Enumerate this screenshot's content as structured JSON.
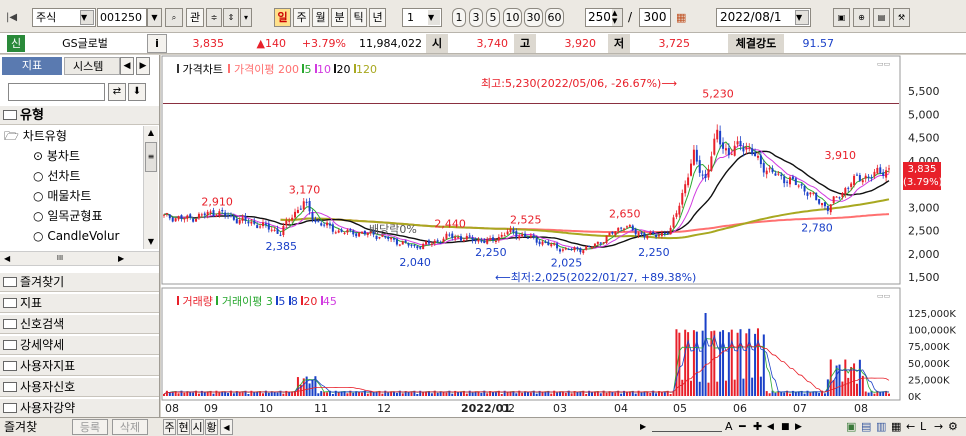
{
  "toolbar": {
    "market": "주식",
    "code": "001250",
    "btn_gwan": "관",
    "periods": [
      "일",
      "주",
      "월",
      "분",
      "틱",
      "년"
    ],
    "interval_value": "1",
    "quick_counts": [
      "1",
      "3",
      "5",
      "10",
      "30",
      "60"
    ],
    "bar_count": "250",
    "slash": "/",
    "total_count": "300",
    "date": "2022/08/1"
  },
  "quote": {
    "badge": "신",
    "name": "GS글로벌",
    "info": "i",
    "price": "3,835",
    "change": "▲140",
    "change_pct": "+3.79%",
    "volume": "11,984,022",
    "open_label": "시",
    "open": "3,740",
    "high_label": "고",
    "high": "3,920",
    "low_label": "저",
    "low": "3,725",
    "strength_label": "체결강도",
    "strength": "91.57"
  },
  "left": {
    "tab_indicator": "지표",
    "tab_system": "시스템",
    "section_type": "유형",
    "tree_parent": "차트유형",
    "chart_types": [
      "봉차트",
      "선차트",
      "매물차트",
      "일목균형표",
      "CandleVolur"
    ],
    "scroll_mid": "III",
    "sections": [
      "즐겨찾기",
      "지표",
      "신호검색",
      "강세약세",
      "사용자지표",
      "사용자신호",
      "사용자강약"
    ]
  },
  "bottom": {
    "label": "즐겨찾",
    "btn_register": "등록",
    "btn_delete": "삭제",
    "tabs": [
      "주",
      "현",
      "시",
      "황"
    ]
  },
  "colors": {
    "up": "#e8202a",
    "down": "#1a40c8",
    "ma5": "#2aa830",
    "ma10": "#d13be0",
    "ma20": "#101010",
    "ma120": "#a8a820",
    "ma200": "#ff7070"
  },
  "price_chart": {
    "title": "가격차트",
    "legend": [
      "가격이평",
      "200",
      "5",
      "10",
      "20",
      "120"
    ],
    "y_labels": [
      "5,500",
      "5,000",
      "4,500",
      "4,000",
      "3,500",
      "3,000",
      "2,500",
      "2,000",
      "1,500"
    ],
    "y_values": [
      5500,
      5000,
      4500,
      4000,
      3500,
      3000,
      2500,
      2000,
      1500
    ],
    "current_price": "3,835",
    "current_pct": "(3.79%)",
    "max_note": "최고:5,230(2022/05/06, -26.67%)⟶",
    "min_note": "⟵최저:2,025(2022/01/27, +89.38%)",
    "dividend_note": "배당락0%",
    "annotations": [
      {
        "text": "2,910",
        "v": 2910
      },
      {
        "text": "3,170",
        "v": 3170
      },
      {
        "text": "2,385",
        "v": 2385
      },
      {
        "text": "2,040",
        "v": 2040
      },
      {
        "text": "2,440",
        "v": 2440
      },
      {
        "text": "2,250",
        "v": 2250
      },
      {
        "text": "2,525",
        "v": 2525
      },
      {
        "text": "2,025",
        "v": 2025
      },
      {
        "text": "2,650",
        "v": 2650
      },
      {
        "text": "2,250",
        "v": 2250
      },
      {
        "text": "5,230",
        "v": 5230
      },
      {
        "text": "3,910",
        "v": 3910
      },
      {
        "text": "2,780",
        "v": 2780
      }
    ]
  },
  "volume_chart": {
    "title": "거래량",
    "legend": [
      "거래이평",
      "3",
      "5",
      "8",
      "20",
      "45"
    ],
    "y_labels": [
      "125,000K",
      "100,000K",
      "75,000K",
      "50,000K",
      "25,000K",
      "0K"
    ]
  },
  "x_axis": [
    "08",
    "09",
    "10",
    "11",
    "12",
    "2022/01",
    "02",
    "03",
    "04",
    "05",
    "06",
    "07",
    "08"
  ]
}
